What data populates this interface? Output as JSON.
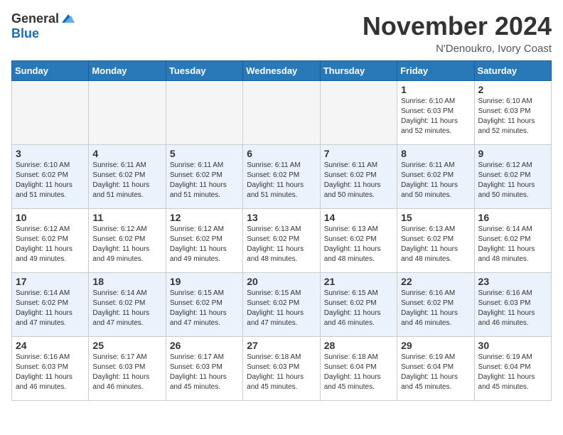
{
  "header": {
    "logo_general": "General",
    "logo_blue": "Blue",
    "month": "November 2024",
    "location": "N'Denoukro, Ivory Coast"
  },
  "weekdays": [
    "Sunday",
    "Monday",
    "Tuesday",
    "Wednesday",
    "Thursday",
    "Friday",
    "Saturday"
  ],
  "weeks": [
    [
      {
        "day": "",
        "empty": true
      },
      {
        "day": "",
        "empty": true
      },
      {
        "day": "",
        "empty": true
      },
      {
        "day": "",
        "empty": true
      },
      {
        "day": "",
        "empty": true
      },
      {
        "day": "1",
        "sunrise": "6:10 AM",
        "sunset": "6:03 PM",
        "daylight": "11 hours and 52 minutes."
      },
      {
        "day": "2",
        "sunrise": "6:10 AM",
        "sunset": "6:03 PM",
        "daylight": "11 hours and 52 minutes."
      }
    ],
    [
      {
        "day": "3",
        "sunrise": "6:10 AM",
        "sunset": "6:02 PM",
        "daylight": "11 hours and 51 minutes."
      },
      {
        "day": "4",
        "sunrise": "6:11 AM",
        "sunset": "6:02 PM",
        "daylight": "11 hours and 51 minutes."
      },
      {
        "day": "5",
        "sunrise": "6:11 AM",
        "sunset": "6:02 PM",
        "daylight": "11 hours and 51 minutes."
      },
      {
        "day": "6",
        "sunrise": "6:11 AM",
        "sunset": "6:02 PM",
        "daylight": "11 hours and 51 minutes."
      },
      {
        "day": "7",
        "sunrise": "6:11 AM",
        "sunset": "6:02 PM",
        "daylight": "11 hours and 50 minutes."
      },
      {
        "day": "8",
        "sunrise": "6:11 AM",
        "sunset": "6:02 PM",
        "daylight": "11 hours and 50 minutes."
      },
      {
        "day": "9",
        "sunrise": "6:12 AM",
        "sunset": "6:02 PM",
        "daylight": "11 hours and 50 minutes."
      }
    ],
    [
      {
        "day": "10",
        "sunrise": "6:12 AM",
        "sunset": "6:02 PM",
        "daylight": "11 hours and 49 minutes."
      },
      {
        "day": "11",
        "sunrise": "6:12 AM",
        "sunset": "6:02 PM",
        "daylight": "11 hours and 49 minutes."
      },
      {
        "day": "12",
        "sunrise": "6:12 AM",
        "sunset": "6:02 PM",
        "daylight": "11 hours and 49 minutes."
      },
      {
        "day": "13",
        "sunrise": "6:13 AM",
        "sunset": "6:02 PM",
        "daylight": "11 hours and 48 minutes."
      },
      {
        "day": "14",
        "sunrise": "6:13 AM",
        "sunset": "6:02 PM",
        "daylight": "11 hours and 48 minutes."
      },
      {
        "day": "15",
        "sunrise": "6:13 AM",
        "sunset": "6:02 PM",
        "daylight": "11 hours and 48 minutes."
      },
      {
        "day": "16",
        "sunrise": "6:14 AM",
        "sunset": "6:02 PM",
        "daylight": "11 hours and 48 minutes."
      }
    ],
    [
      {
        "day": "17",
        "sunrise": "6:14 AM",
        "sunset": "6:02 PM",
        "daylight": "11 hours and 47 minutes."
      },
      {
        "day": "18",
        "sunrise": "6:14 AM",
        "sunset": "6:02 PM",
        "daylight": "11 hours and 47 minutes."
      },
      {
        "day": "19",
        "sunrise": "6:15 AM",
        "sunset": "6:02 PM",
        "daylight": "11 hours and 47 minutes."
      },
      {
        "day": "20",
        "sunrise": "6:15 AM",
        "sunset": "6:02 PM",
        "daylight": "11 hours and 47 minutes."
      },
      {
        "day": "21",
        "sunrise": "6:15 AM",
        "sunset": "6:02 PM",
        "daylight": "11 hours and 46 minutes."
      },
      {
        "day": "22",
        "sunrise": "6:16 AM",
        "sunset": "6:02 PM",
        "daylight": "11 hours and 46 minutes."
      },
      {
        "day": "23",
        "sunrise": "6:16 AM",
        "sunset": "6:03 PM",
        "daylight": "11 hours and 46 minutes."
      }
    ],
    [
      {
        "day": "24",
        "sunrise": "6:16 AM",
        "sunset": "6:03 PM",
        "daylight": "11 hours and 46 minutes."
      },
      {
        "day": "25",
        "sunrise": "6:17 AM",
        "sunset": "6:03 PM",
        "daylight": "11 hours and 46 minutes."
      },
      {
        "day": "26",
        "sunrise": "6:17 AM",
        "sunset": "6:03 PM",
        "daylight": "11 hours and 45 minutes."
      },
      {
        "day": "27",
        "sunrise": "6:18 AM",
        "sunset": "6:03 PM",
        "daylight": "11 hours and 45 minutes."
      },
      {
        "day": "28",
        "sunrise": "6:18 AM",
        "sunset": "6:04 PM",
        "daylight": "11 hours and 45 minutes."
      },
      {
        "day": "29",
        "sunrise": "6:19 AM",
        "sunset": "6:04 PM",
        "daylight": "11 hours and 45 minutes."
      },
      {
        "day": "30",
        "sunrise": "6:19 AM",
        "sunset": "6:04 PM",
        "daylight": "11 hours and 45 minutes."
      }
    ]
  ]
}
